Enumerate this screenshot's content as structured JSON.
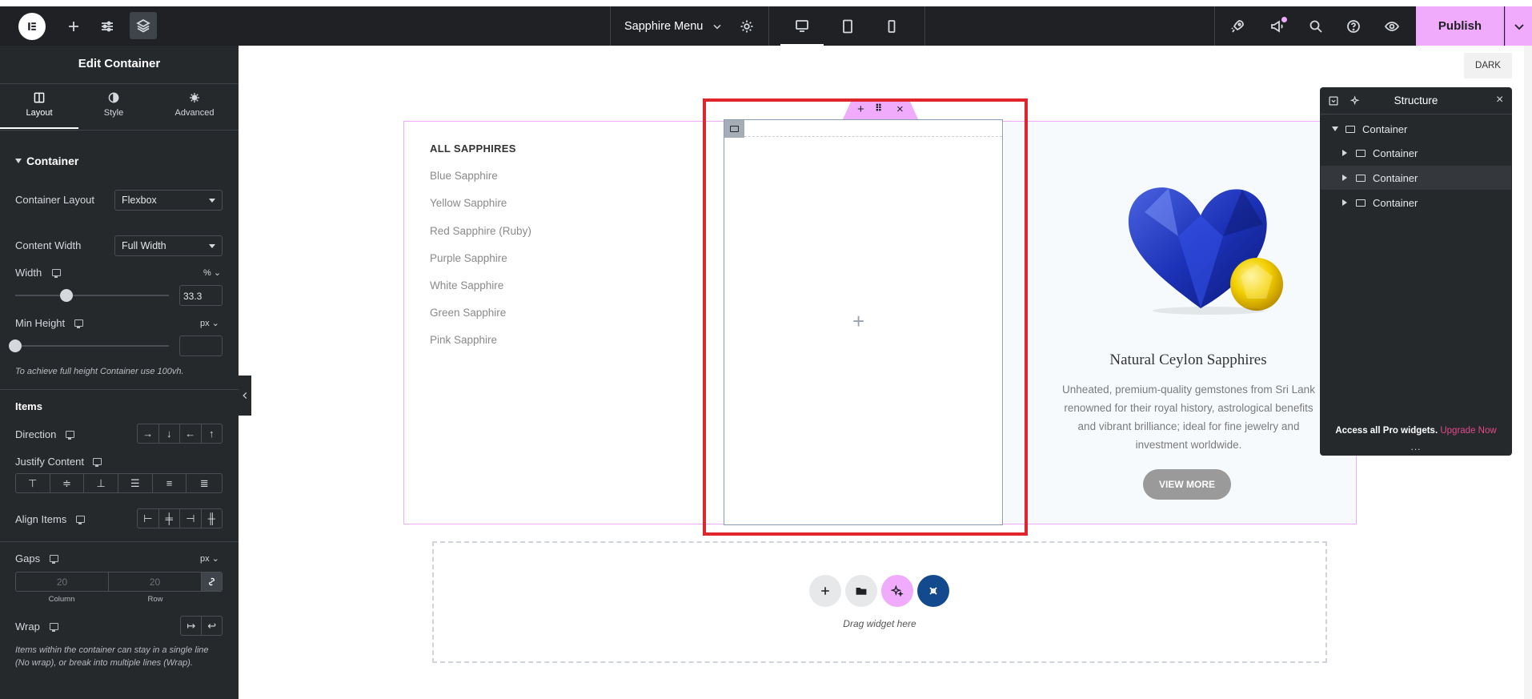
{
  "topbar": {
    "page_title": "Sapphire Menu",
    "publish_label": "Publish"
  },
  "panel": {
    "title": "Edit Container",
    "tabs": [
      {
        "label": "Layout",
        "icon": "layout-icon",
        "active": true
      },
      {
        "label": "Style",
        "icon": "half-circle-icon",
        "active": false
      },
      {
        "label": "Advanced",
        "icon": "gear-icon",
        "active": false
      }
    ],
    "section_title": "Container",
    "container_layout": {
      "label": "Container Layout",
      "value": "Flexbox"
    },
    "content_width": {
      "label": "Content Width",
      "value": "Full Width"
    },
    "width": {
      "label": "Width",
      "unit": "%",
      "value": "33.3",
      "slider_fraction": 0.333
    },
    "min_height": {
      "label": "Min Height",
      "unit": "px",
      "value": ""
    },
    "min_height_note": "To achieve full height Container use 100vh.",
    "items_title": "Items",
    "direction_label": "Direction",
    "justify_label": "Justify Content",
    "align_label": "Align Items",
    "gaps": {
      "label": "Gaps",
      "unit": "px",
      "column_placeholder": "20",
      "row_placeholder": "20",
      "column_label": "Column",
      "row_label": "Row"
    },
    "wrap_label": "Wrap",
    "wrap_note": "Items within the container can stay in a single line (No wrap), or break into multiple lines (Wrap)."
  },
  "canvas": {
    "dark_label": "DARK",
    "menu_heading": "ALL SAPPHIRES",
    "menu_items": [
      "Blue Sapphire",
      "Yellow Sapphire",
      "Red Sapphire (Ruby)",
      "Purple Sapphire",
      "White Sapphire",
      "Green Sapphire",
      "Pink Sapphire"
    ],
    "card_title": "Natural Ceylon Sapphires",
    "card_text_lines": [
      "Unheated, premium-quality gemstones from Sri Lank",
      "renowned for their royal history, astrological benefits",
      "and vibrant brilliance; ideal for fine jewelry and",
      "investment worldwide."
    ],
    "card_button": "VIEW MORE",
    "drag_text": "Drag widget here"
  },
  "structure": {
    "title": "Structure",
    "root": "Container",
    "children": [
      "Container",
      "Container",
      "Container"
    ],
    "promo_text": "Access all Pro widgets.",
    "promo_link": "Upgrade Now",
    "more": "..."
  },
  "colors": {
    "accent_pink": "#f0abfc",
    "selection_red": "#e0262d",
    "dark_bg": "#1f2124",
    "panel_bg": "#26292c",
    "link_pink": "#e2498a"
  }
}
